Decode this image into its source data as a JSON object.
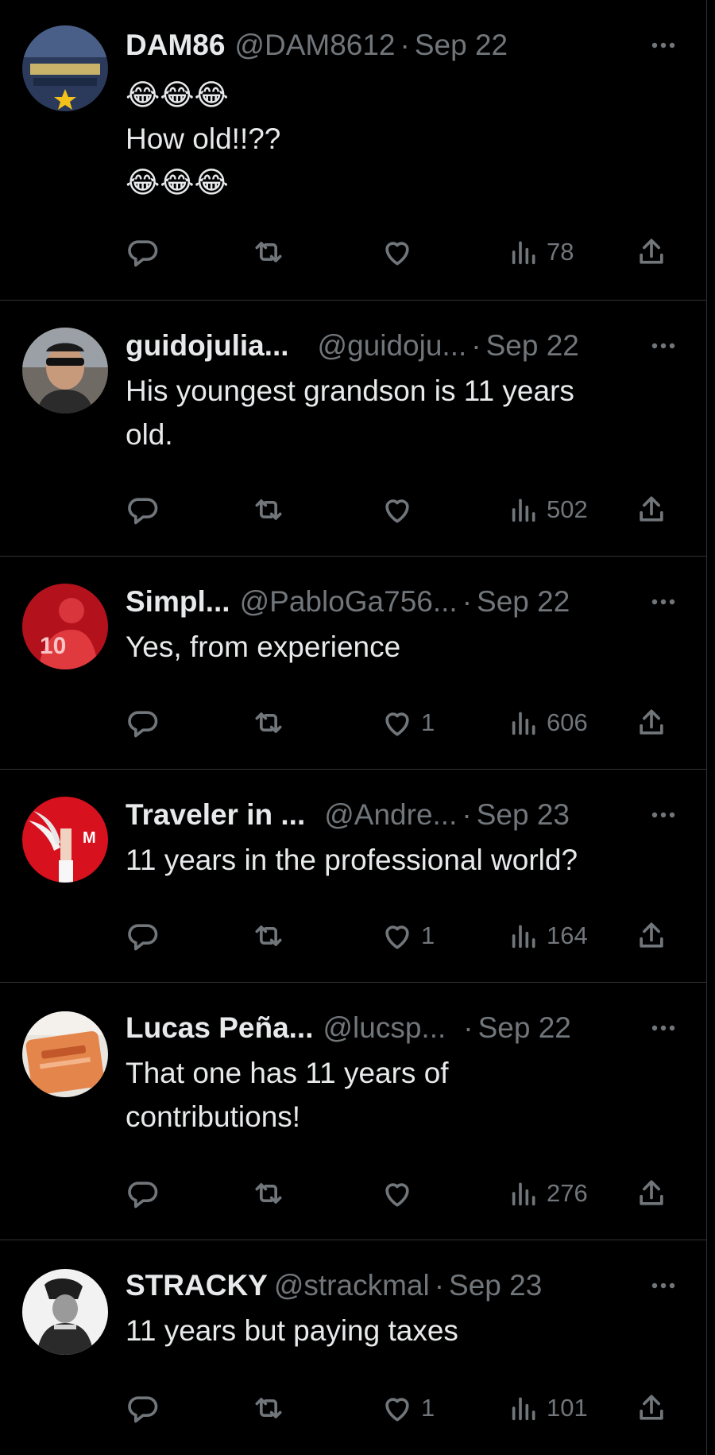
{
  "tweets": [
    {
      "name": "DAM86",
      "handle": "@DAM8612",
      "date": "Sep 22",
      "text_lines": [
        "😂😂😂",
        "How old!!??",
        "😂😂😂"
      ],
      "likes": "",
      "views": "78",
      "avatar": "blue-yellow-crest"
    },
    {
      "name": "guidojulia...",
      "handle": "@guidoju...",
      "date": "Sep 22",
      "text_lines": [
        "His youngest grandson is 11 years",
        "old."
      ],
      "likes": "",
      "views": "502",
      "avatar": "man-sunglasses"
    },
    {
      "name": "Simpl...",
      "handle": "@PabloGa756...",
      "date": "Sep 22",
      "text_lines": [
        "Yes, from experience"
      ],
      "likes": "1",
      "views": "606",
      "avatar": "red-jersey-10"
    },
    {
      "name": "Traveler in ...",
      "handle": "@Andre...",
      "date": "Sep 23",
      "text_lines": [
        "11 years in the professional world?"
      ],
      "likes": "1",
      "views": "164",
      "avatar": "red-wings"
    },
    {
      "name": "Lucas Peña...",
      "handle": "@lucsp...",
      "date": "Sep 22",
      "text_lines": [
        "That one has 11 years of",
        "contributions!"
      ],
      "likes": "",
      "views": "276",
      "avatar": "orange-card"
    },
    {
      "name": "STRACKY",
      "handle": "@strackmal",
      "date": "Sep 23",
      "text_lines": [
        "11 years but paying taxes"
      ],
      "likes": "1",
      "views": "101",
      "avatar": "bw-figure"
    }
  ],
  "colors": {
    "background": "#000000",
    "text": "#e7e9ea",
    "muted": "#71767b",
    "divider": "#2f3336"
  },
  "icons": [
    "reply-icon",
    "retweet-icon",
    "like-icon",
    "views-icon",
    "share-icon",
    "more-icon"
  ]
}
